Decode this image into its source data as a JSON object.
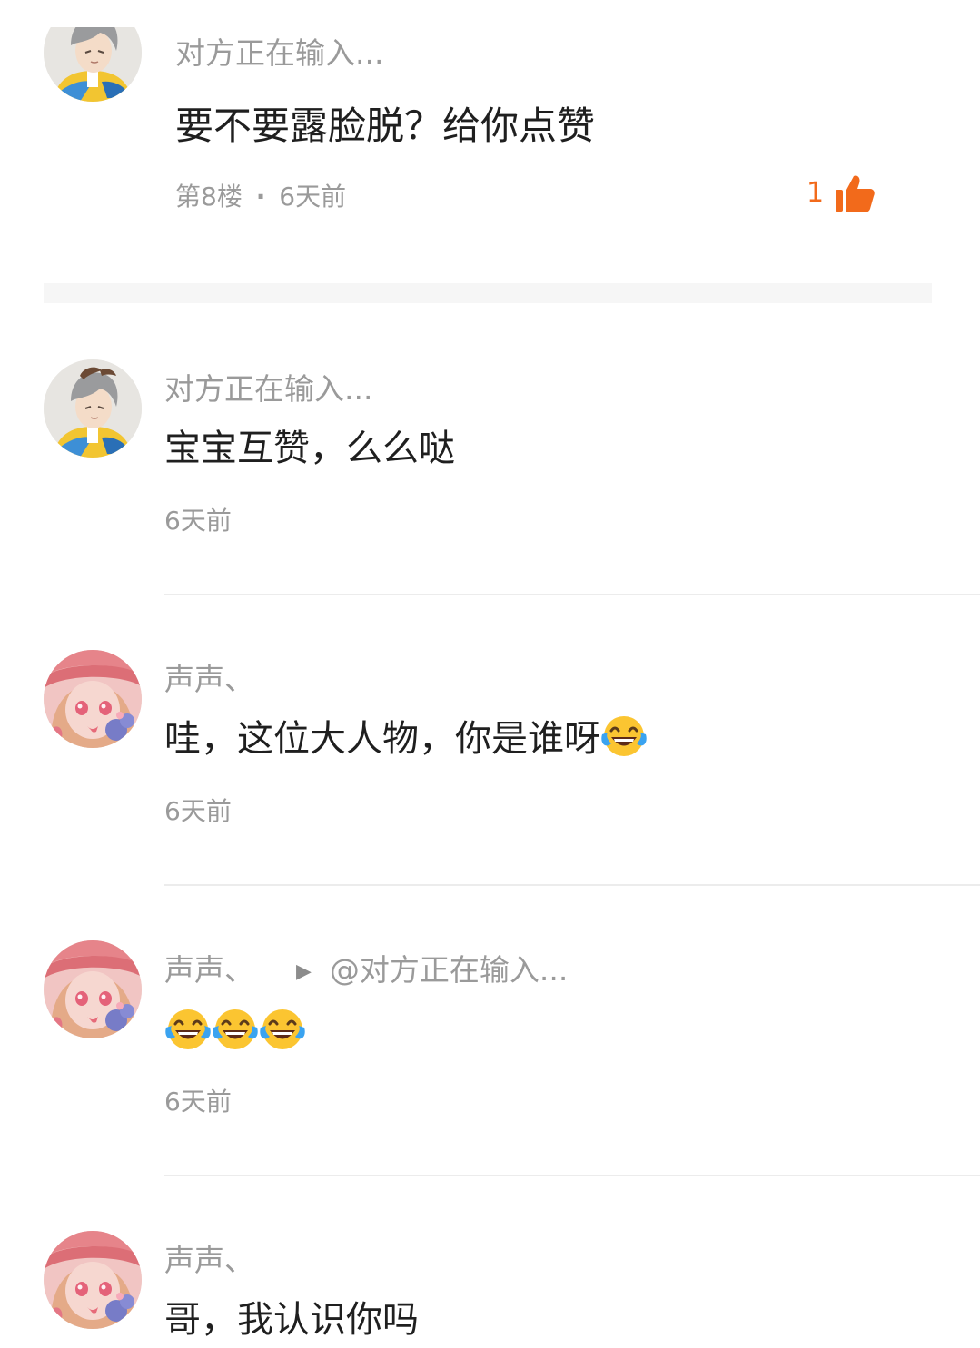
{
  "floor_post": {
    "username": "对方正在输入...",
    "content": "要不要露脸脱？给你点赞",
    "floor": "第8楼",
    "separator": "·",
    "time": "6天前",
    "like_count": "1",
    "like_icon": "thumbs-up-icon",
    "accent_color": "#f26a1b"
  },
  "replies": [
    {
      "username": "对方正在输入...",
      "content": "宝宝互赞，么么哒",
      "time": "6天前"
    },
    {
      "username": "声声、",
      "content": "哇，这位大人物，你是谁呀",
      "emoji": "laughing-tears-emoji",
      "time": "6天前"
    },
    {
      "username": "声声、",
      "reply_arrow": "▶",
      "reply_to": "@对方正在输入...",
      "emojis": [
        "laughing-tears-emoji",
        "laughing-tears-emoji",
        "laughing-tears-emoji"
      ],
      "time": "6天前"
    },
    {
      "username": "声声、",
      "content": "哥，我认识你吗"
    }
  ]
}
